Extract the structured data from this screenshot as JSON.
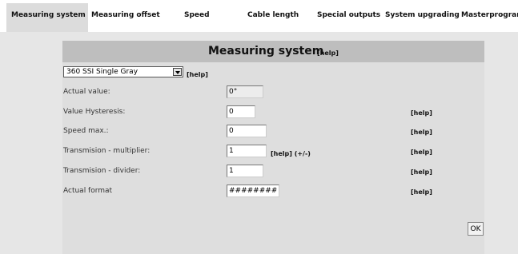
{
  "tabs": [
    {
      "label": "Measuring system",
      "active": true
    },
    {
      "label": "Measuring offset"
    },
    {
      "label": "Speed"
    },
    {
      "label": "Cable length"
    },
    {
      "label": "Special outputs"
    },
    {
      "label": "System upgrading"
    },
    {
      "label": "Masterprogram"
    }
  ],
  "panel": {
    "title": "Measuring system",
    "title_help": "[help]"
  },
  "encoder_select": {
    "value": "360 SSI Single Gray",
    "help": "[help]"
  },
  "rows": [
    {
      "label": "Actual value:",
      "value": "0°",
      "readonly": true
    },
    {
      "label": "Value Hysteresis:",
      "value": "0",
      "help": "[help]"
    },
    {
      "label": "Speed max.:",
      "value": "0",
      "help": "[help]"
    },
    {
      "label": "Transmision - multiplier:",
      "value": "1",
      "inline_help": "[help] (+/-)",
      "help": "[help]"
    },
    {
      "label": "Transmision - divider:",
      "value": "1",
      "help": "[help]"
    },
    {
      "label": "Actual format",
      "value": "########°",
      "help": "[help]"
    }
  ],
  "ok_label": "OK",
  "colors": {
    "background": "#e6e6e6",
    "panel": "#dedede",
    "panel_header": "#bebebe",
    "tabbar": "#ffffff",
    "active_tab": "#dcdcdc"
  }
}
